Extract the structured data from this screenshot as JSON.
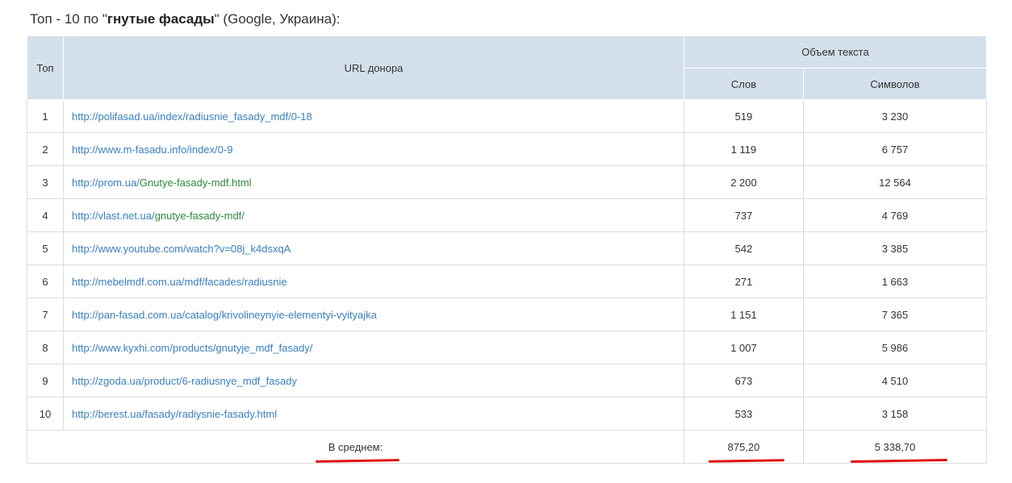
{
  "title": {
    "prefix": "Топ - 10 по \"",
    "keyword": "гнутые фасады",
    "suffix": "\" (Google, Украина):"
  },
  "table": {
    "headers": {
      "top": "Топ",
      "url": "URL донора",
      "volume": "Объем текста",
      "words": "Слов",
      "chars": "Символов"
    },
    "rows": [
      {
        "rank": "1",
        "url_main": "http://polifasad.ua/index/radiusnie_fasady_mdf/0-18",
        "url_tail": "",
        "words": "519",
        "chars": "3 230"
      },
      {
        "rank": "2",
        "url_main": "http://www.m-fasadu.info/index/0-9",
        "url_tail": "",
        "words": "1 119",
        "chars": "6 757"
      },
      {
        "rank": "3",
        "url_main": "http://prom.ua/",
        "url_tail": "Gnutye-fasady-mdf.html",
        "words": "2 200",
        "chars": "12 564"
      },
      {
        "rank": "4",
        "url_main": "http://vlast.net.ua/",
        "url_tail": "gnutye-fasady-mdf/",
        "words": "737",
        "chars": "4 769"
      },
      {
        "rank": "5",
        "url_main": "http://www.youtube.com/watch?v=08j_k4dsxqA",
        "url_tail": "",
        "words": "542",
        "chars": "3 385"
      },
      {
        "rank": "6",
        "url_main": "http://mebelmdf.com.ua/mdf/facades/radiusnie",
        "url_tail": "",
        "words": "271",
        "chars": "1 663"
      },
      {
        "rank": "7",
        "url_main": "http://pan-fasad.com.ua/catalog/krivolineynyie-elementyi-vyityajka",
        "url_tail": "",
        "words": "1 151",
        "chars": "7 365"
      },
      {
        "rank": "8",
        "url_main": "http://www.kyxhi.com/products/gnutyje_mdf_fasady/",
        "url_tail": "",
        "words": "1 007",
        "chars": "5 986"
      },
      {
        "rank": "9",
        "url_main": "http://zgoda.ua/product/6-radiusnye_mdf_fasady",
        "url_tail": "",
        "words": "673",
        "chars": "4 510"
      },
      {
        "rank": "10",
        "url_main": "http://berest.ua/fasady/radiysnie-fasady.html",
        "url_tail": "",
        "words": "533",
        "chars": "3 158"
      }
    ],
    "average": {
      "label": "В среднем:",
      "words": "875,20",
      "chars": "5 338,70"
    }
  },
  "colors": {
    "header_bg": "#d3e0ec",
    "link": "#3a7fbf",
    "link_visited_tail": "#2e8b3a",
    "highlight_underline": "#e01010"
  }
}
